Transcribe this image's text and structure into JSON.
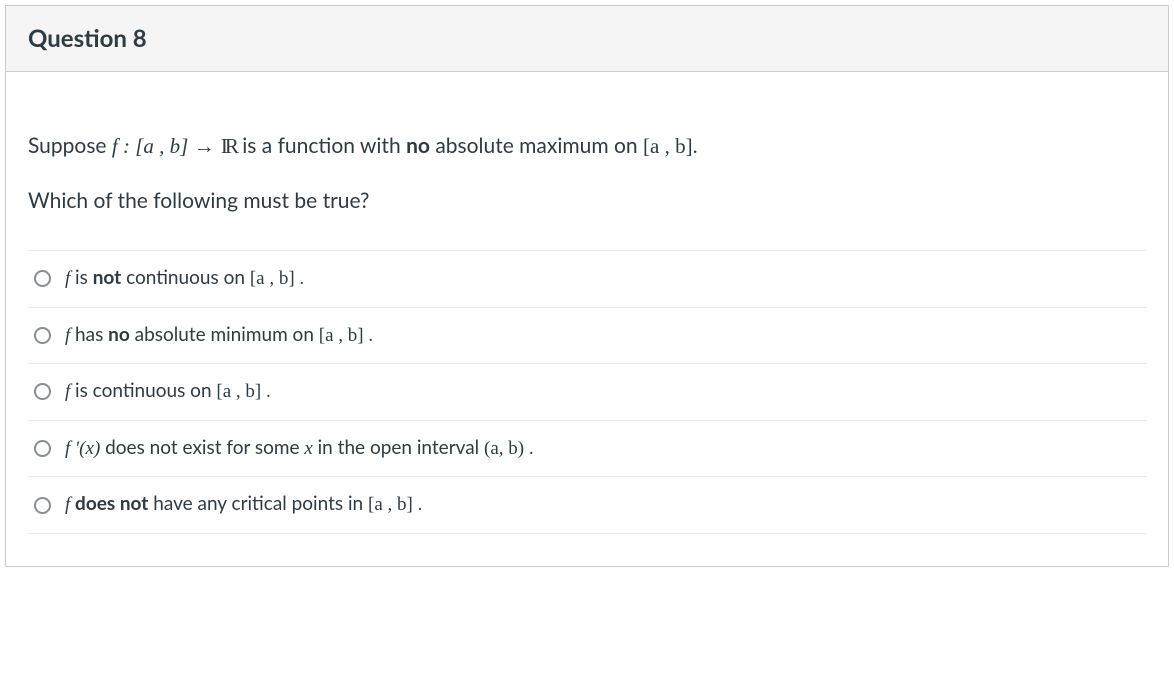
{
  "header": {
    "title": "Question 8"
  },
  "prompt": {
    "l1a": "Suppose ",
    "l1_fn": "f : [a , b] → ",
    "l1_R": "R",
    "l1b": " is a function with ",
    "l1_bold": "no",
    "l1c": " absolute maximum on ",
    "l1_dom": "[a , b].",
    "l2": "Which of the following must be true?"
  },
  "answers": {
    "a1_f": "f ",
    "a1_t1": "is ",
    "a1_b": "not",
    "a1_t2": " continuous on ",
    "a1_m": "[a , b] .",
    "a2_f": "f ",
    "a2_t1": "has ",
    "a2_b": "no",
    "a2_t2": " absolute minimum on ",
    "a2_m": "[a , b] .",
    "a3_f": "f ",
    "a3_t1": "is continuous on ",
    "a3_m": "[a , b] .",
    "a4_f": "f ′(x)",
    "a4_t1": " does not exist for some ",
    "a4_x": "x ",
    "a4_t2": " in the open interval ",
    "a4_m": "(a, b) .",
    "a5_f": "f ",
    "a5_b": "does not",
    "a5_t1": " have any critical points in ",
    "a5_m": "[a , b] ."
  }
}
